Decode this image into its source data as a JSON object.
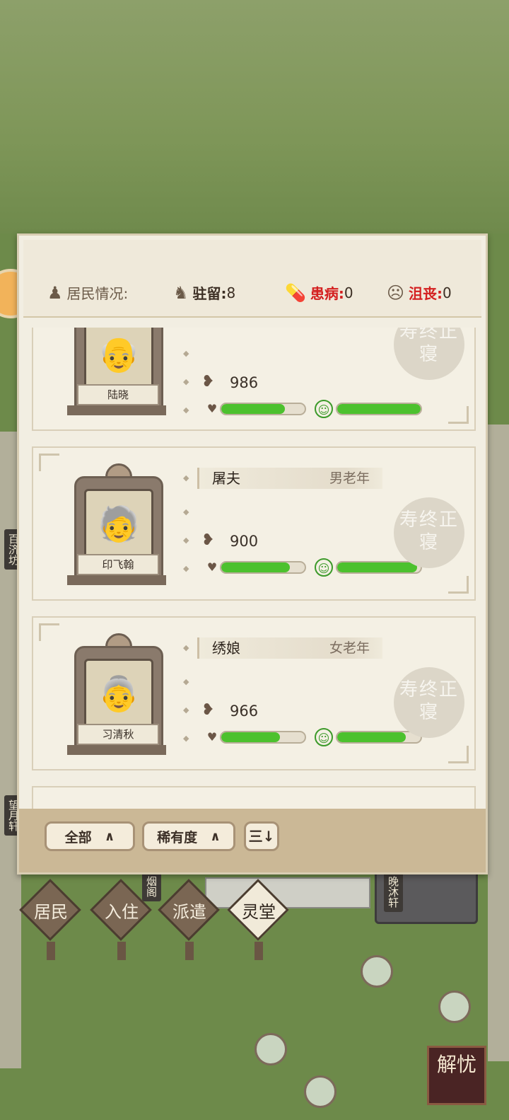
{
  "header": {
    "title": "居民情况:",
    "stay_label": "驻留:",
    "stay_value": "8",
    "sick_label": "患病:",
    "sick_value": "0",
    "depressed_label": "沮丧:",
    "depressed_value": "0"
  },
  "residents": [
    {
      "name": "陆晓",
      "job": "",
      "age_group": "",
      "value": "986",
      "health_fill": 0.76,
      "mood_fill": 1.0,
      "stamp": "寿终正寝"
    },
    {
      "name": "印飞翰",
      "job": "屠夫",
      "age_group": "男老年",
      "value": "900",
      "health_fill": 0.82,
      "mood_fill": 0.96,
      "stamp": "寿终正寝"
    },
    {
      "name": "习清秋",
      "job": "绣娘",
      "age_group": "女老年",
      "value": "966",
      "health_fill": 0.7,
      "mood_fill": 0.82,
      "stamp": "寿终正寝"
    }
  ],
  "filters": {
    "all_label": "全部",
    "rarity_label": "稀有度",
    "sort_label": "三↓"
  },
  "tabs": [
    {
      "label": "居民",
      "active": false
    },
    {
      "label": "入住",
      "active": false
    },
    {
      "label": "派遣",
      "active": false
    },
    {
      "label": "灵堂",
      "active": true
    }
  ],
  "map_labels": [
    "晚沐轩",
    "烟阁",
    "望月轩",
    "百济坊"
  ],
  "solve_button": "解忧",
  "colors": {
    "bar_green": "#4cc12e",
    "alert_red": "#d42020"
  }
}
